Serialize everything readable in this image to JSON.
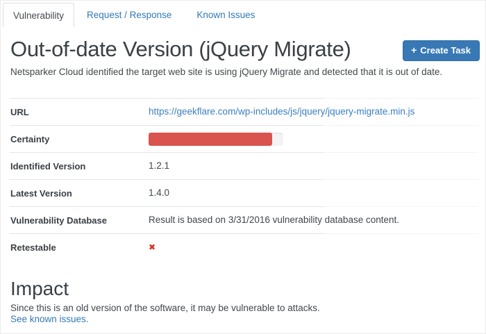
{
  "colors": {
    "accent_blue": "#3279B7",
    "button_blue": "#3879B5",
    "danger_red": "#D9534F",
    "cross_red": "#E02B1E"
  },
  "tabs": [
    {
      "label": "Vulnerability",
      "active": true
    },
    {
      "label": "Request / Response",
      "active": false
    },
    {
      "label": "Known Issues",
      "active": false
    }
  ],
  "header": {
    "title": "Out-of-date Version (jQuery Migrate)",
    "create_task": {
      "icon": "+",
      "label": "Create Task"
    },
    "description": "Netsparker Cloud identified the target web site is using jQuery Migrate and detected that it is out of date."
  },
  "details": {
    "url": {
      "label": "URL",
      "value": "https://geekflare.com/wp-includes/js/jquery/jquery-migrate.min.js"
    },
    "certainty": {
      "label": "Certainty",
      "percent": 92
    },
    "identified_version": {
      "label": "Identified Version",
      "value": "1.2.1"
    },
    "latest_version": {
      "label": "Latest Version",
      "value": "1.4.0"
    },
    "vulnerability_database": {
      "label": "Vulnerability Database",
      "value": "Result is based on 3/31/2016 vulnerability database content."
    },
    "retestable": {
      "label": "Retestable",
      "icon": "✖"
    }
  },
  "impact": {
    "title": "Impact",
    "description": "Since this is an old version of the software, it may be vulnerable to attacks.",
    "link": "See known issues."
  }
}
